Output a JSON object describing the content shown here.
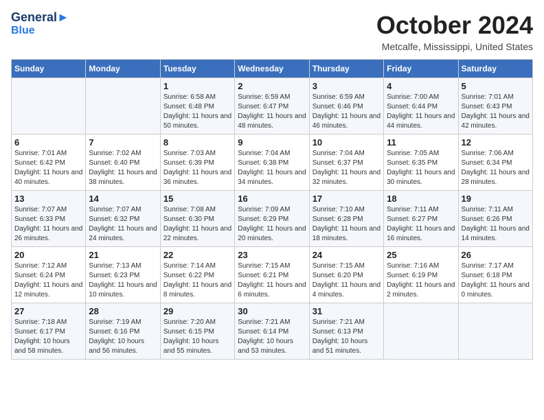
{
  "header": {
    "logo_line1": "General",
    "logo_line2": "Blue",
    "month_title": "October 2024",
    "location": "Metcalfe, Mississippi, United States"
  },
  "days_of_week": [
    "Sunday",
    "Monday",
    "Tuesday",
    "Wednesday",
    "Thursday",
    "Friday",
    "Saturday"
  ],
  "weeks": [
    [
      {
        "day": "",
        "sunrise": "",
        "sunset": "",
        "daylight": ""
      },
      {
        "day": "",
        "sunrise": "",
        "sunset": "",
        "daylight": ""
      },
      {
        "day": "1",
        "sunrise": "Sunrise: 6:58 AM",
        "sunset": "Sunset: 6:48 PM",
        "daylight": "Daylight: 11 hours and 50 minutes."
      },
      {
        "day": "2",
        "sunrise": "Sunrise: 6:59 AM",
        "sunset": "Sunset: 6:47 PM",
        "daylight": "Daylight: 11 hours and 48 minutes."
      },
      {
        "day": "3",
        "sunrise": "Sunrise: 6:59 AM",
        "sunset": "Sunset: 6:46 PM",
        "daylight": "Daylight: 11 hours and 46 minutes."
      },
      {
        "day": "4",
        "sunrise": "Sunrise: 7:00 AM",
        "sunset": "Sunset: 6:44 PM",
        "daylight": "Daylight: 11 hours and 44 minutes."
      },
      {
        "day": "5",
        "sunrise": "Sunrise: 7:01 AM",
        "sunset": "Sunset: 6:43 PM",
        "daylight": "Daylight: 11 hours and 42 minutes."
      }
    ],
    [
      {
        "day": "6",
        "sunrise": "Sunrise: 7:01 AM",
        "sunset": "Sunset: 6:42 PM",
        "daylight": "Daylight: 11 hours and 40 minutes."
      },
      {
        "day": "7",
        "sunrise": "Sunrise: 7:02 AM",
        "sunset": "Sunset: 6:40 PM",
        "daylight": "Daylight: 11 hours and 38 minutes."
      },
      {
        "day": "8",
        "sunrise": "Sunrise: 7:03 AM",
        "sunset": "Sunset: 6:39 PM",
        "daylight": "Daylight: 11 hours and 36 minutes."
      },
      {
        "day": "9",
        "sunrise": "Sunrise: 7:04 AM",
        "sunset": "Sunset: 6:38 PM",
        "daylight": "Daylight: 11 hours and 34 minutes."
      },
      {
        "day": "10",
        "sunrise": "Sunrise: 7:04 AM",
        "sunset": "Sunset: 6:37 PM",
        "daylight": "Daylight: 11 hours and 32 minutes."
      },
      {
        "day": "11",
        "sunrise": "Sunrise: 7:05 AM",
        "sunset": "Sunset: 6:35 PM",
        "daylight": "Daylight: 11 hours and 30 minutes."
      },
      {
        "day": "12",
        "sunrise": "Sunrise: 7:06 AM",
        "sunset": "Sunset: 6:34 PM",
        "daylight": "Daylight: 11 hours and 28 minutes."
      }
    ],
    [
      {
        "day": "13",
        "sunrise": "Sunrise: 7:07 AM",
        "sunset": "Sunset: 6:33 PM",
        "daylight": "Daylight: 11 hours and 26 minutes."
      },
      {
        "day": "14",
        "sunrise": "Sunrise: 7:07 AM",
        "sunset": "Sunset: 6:32 PM",
        "daylight": "Daylight: 11 hours and 24 minutes."
      },
      {
        "day": "15",
        "sunrise": "Sunrise: 7:08 AM",
        "sunset": "Sunset: 6:30 PM",
        "daylight": "Daylight: 11 hours and 22 minutes."
      },
      {
        "day": "16",
        "sunrise": "Sunrise: 7:09 AM",
        "sunset": "Sunset: 6:29 PM",
        "daylight": "Daylight: 11 hours and 20 minutes."
      },
      {
        "day": "17",
        "sunrise": "Sunrise: 7:10 AM",
        "sunset": "Sunset: 6:28 PM",
        "daylight": "Daylight: 11 hours and 18 minutes."
      },
      {
        "day": "18",
        "sunrise": "Sunrise: 7:11 AM",
        "sunset": "Sunset: 6:27 PM",
        "daylight": "Daylight: 11 hours and 16 minutes."
      },
      {
        "day": "19",
        "sunrise": "Sunrise: 7:11 AM",
        "sunset": "Sunset: 6:26 PM",
        "daylight": "Daylight: 11 hours and 14 minutes."
      }
    ],
    [
      {
        "day": "20",
        "sunrise": "Sunrise: 7:12 AM",
        "sunset": "Sunset: 6:24 PM",
        "daylight": "Daylight: 11 hours and 12 minutes."
      },
      {
        "day": "21",
        "sunrise": "Sunrise: 7:13 AM",
        "sunset": "Sunset: 6:23 PM",
        "daylight": "Daylight: 11 hours and 10 minutes."
      },
      {
        "day": "22",
        "sunrise": "Sunrise: 7:14 AM",
        "sunset": "Sunset: 6:22 PM",
        "daylight": "Daylight: 11 hours and 8 minutes."
      },
      {
        "day": "23",
        "sunrise": "Sunrise: 7:15 AM",
        "sunset": "Sunset: 6:21 PM",
        "daylight": "Daylight: 11 hours and 6 minutes."
      },
      {
        "day": "24",
        "sunrise": "Sunrise: 7:15 AM",
        "sunset": "Sunset: 6:20 PM",
        "daylight": "Daylight: 11 hours and 4 minutes."
      },
      {
        "day": "25",
        "sunrise": "Sunrise: 7:16 AM",
        "sunset": "Sunset: 6:19 PM",
        "daylight": "Daylight: 11 hours and 2 minutes."
      },
      {
        "day": "26",
        "sunrise": "Sunrise: 7:17 AM",
        "sunset": "Sunset: 6:18 PM",
        "daylight": "Daylight: 11 hours and 0 minutes."
      }
    ],
    [
      {
        "day": "27",
        "sunrise": "Sunrise: 7:18 AM",
        "sunset": "Sunset: 6:17 PM",
        "daylight": "Daylight: 10 hours and 58 minutes."
      },
      {
        "day": "28",
        "sunrise": "Sunrise: 7:19 AM",
        "sunset": "Sunset: 6:16 PM",
        "daylight": "Daylight: 10 hours and 56 minutes."
      },
      {
        "day": "29",
        "sunrise": "Sunrise: 7:20 AM",
        "sunset": "Sunset: 6:15 PM",
        "daylight": "Daylight: 10 hours and 55 minutes."
      },
      {
        "day": "30",
        "sunrise": "Sunrise: 7:21 AM",
        "sunset": "Sunset: 6:14 PM",
        "daylight": "Daylight: 10 hours and 53 minutes."
      },
      {
        "day": "31",
        "sunrise": "Sunrise: 7:21 AM",
        "sunset": "Sunset: 6:13 PM",
        "daylight": "Daylight: 10 hours and 51 minutes."
      },
      {
        "day": "",
        "sunrise": "",
        "sunset": "",
        "daylight": ""
      },
      {
        "day": "",
        "sunrise": "",
        "sunset": "",
        "daylight": ""
      }
    ]
  ]
}
